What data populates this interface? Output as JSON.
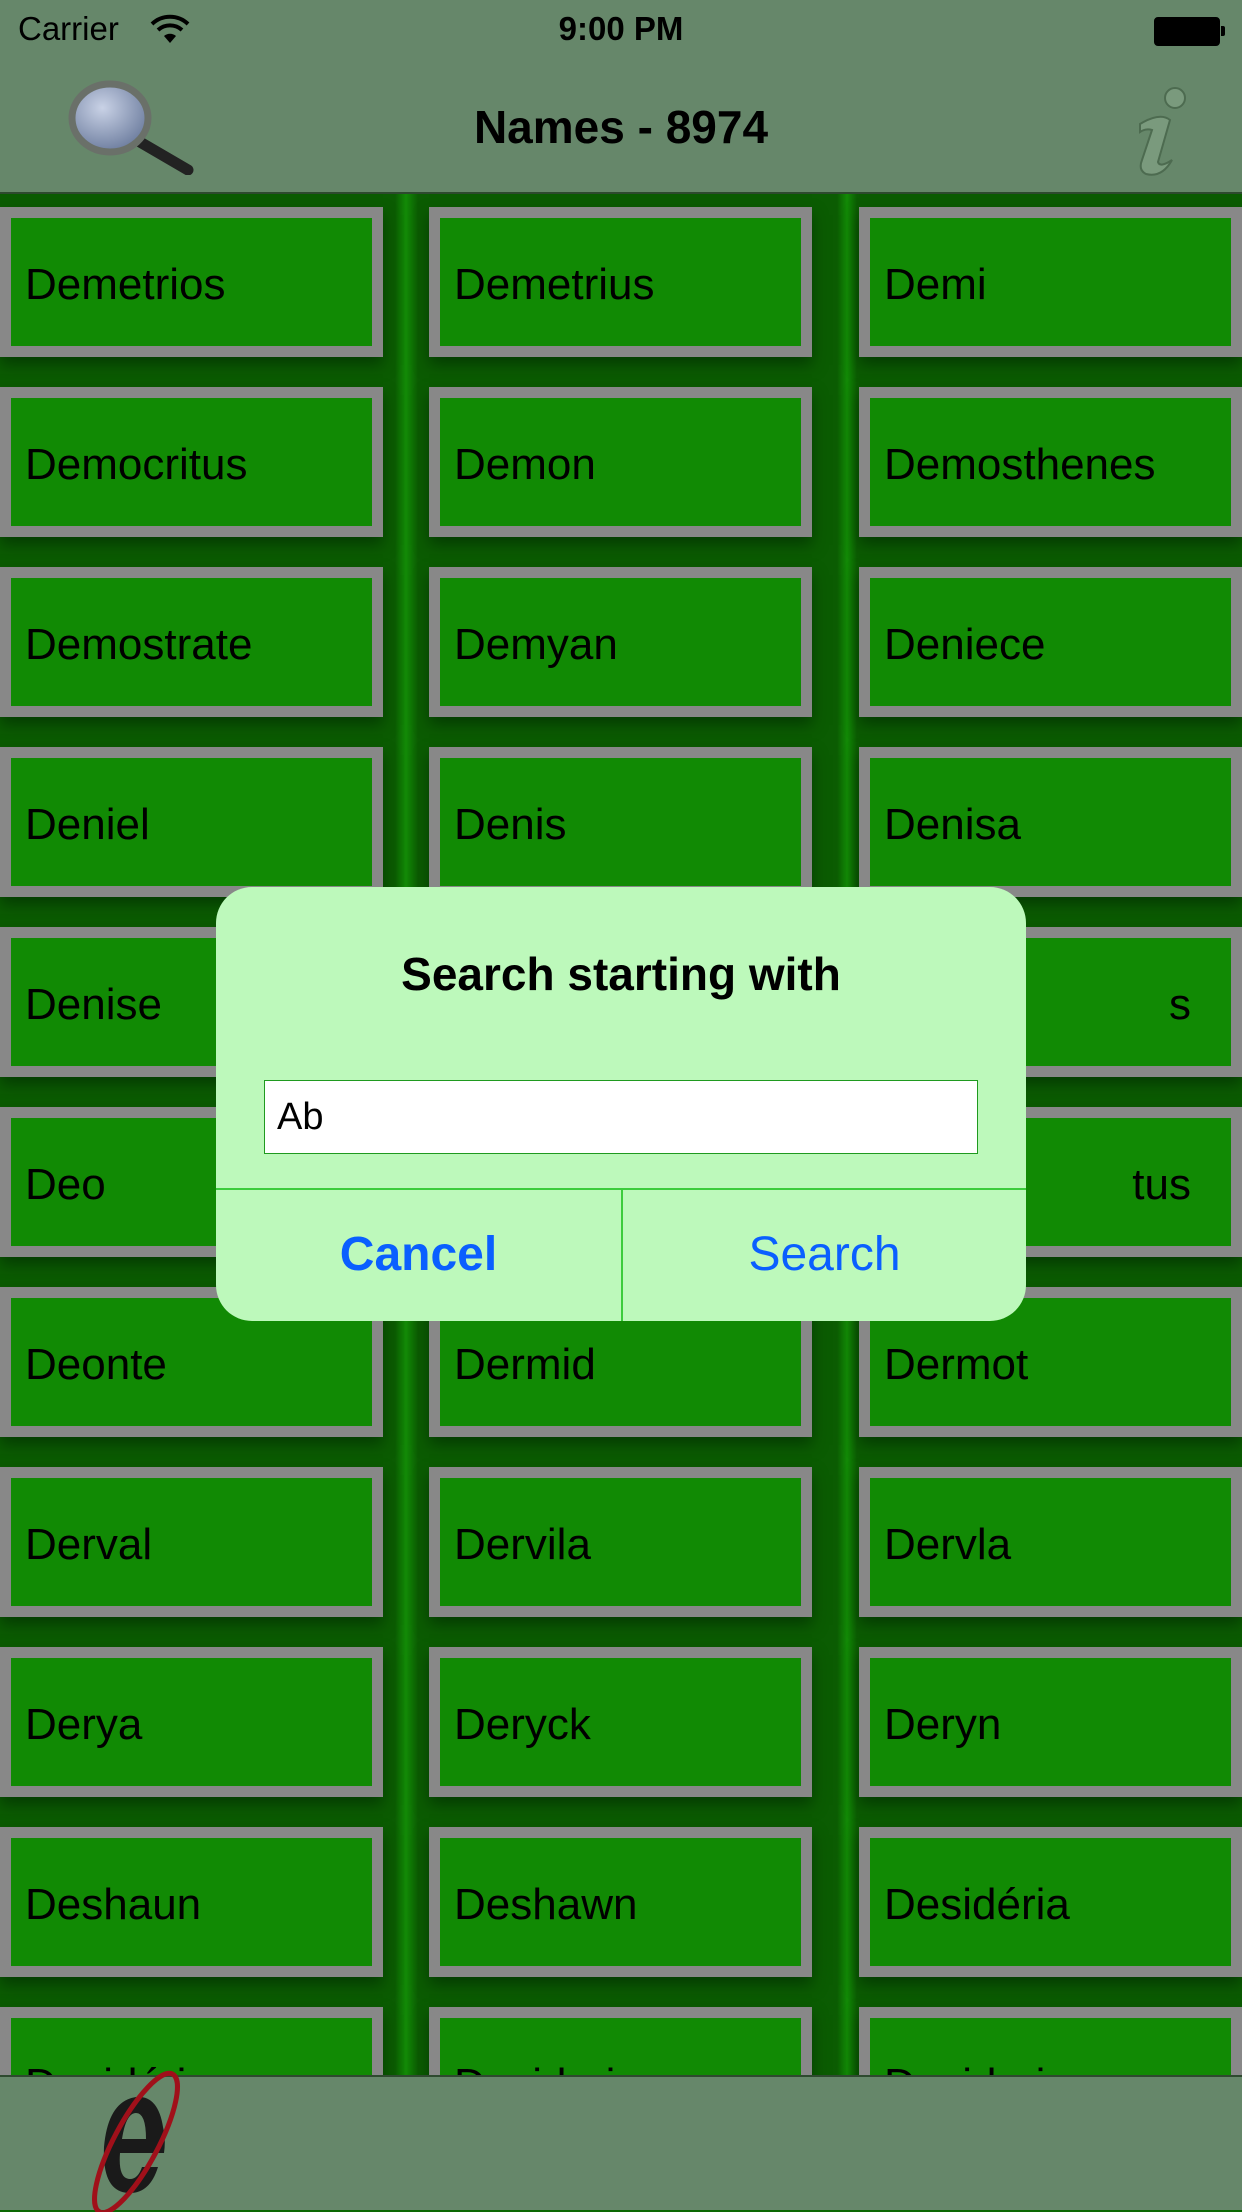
{
  "status_bar": {
    "carrier": "Carrier",
    "time": "9:00 PM"
  },
  "nav": {
    "title": "Names - 8974",
    "left_icon": "magnifier-icon",
    "right_icon": "info-icon"
  },
  "colors": {
    "cell_fill": "#118a04",
    "cell_border": "#888888",
    "bar": "#66876a",
    "dialog": "#bdf9bb",
    "button_text": "#0a5fff"
  },
  "names": [
    [
      "Demetrios",
      "Demetrius",
      "Demi"
    ],
    [
      "Democritus",
      "Demon",
      "Demosthenes"
    ],
    [
      "Demostrate",
      "Demyan",
      "Deniece"
    ],
    [
      "Deniel",
      "Denis",
      "Denisa"
    ],
    [
      "Denise",
      "",
      "s"
    ],
    [
      "Deo",
      "",
      "tus"
    ],
    [
      "Deonte",
      "Dermid",
      "Dermot"
    ],
    [
      "Derval",
      "Dervila",
      "Dervla"
    ],
    [
      "Derya",
      "Deryck",
      "Deryn"
    ],
    [
      "Deshaun",
      "Deshawn",
      "Desidéria"
    ],
    [
      "Desidério",
      "Desiderio",
      "Desideria"
    ]
  ],
  "dialog": {
    "title": "Search starting with",
    "input_value": "Ab",
    "cancel_label": "Cancel",
    "search_label": "Search"
  },
  "bottom_bar": {
    "logo_icon": "e-logo-icon"
  }
}
